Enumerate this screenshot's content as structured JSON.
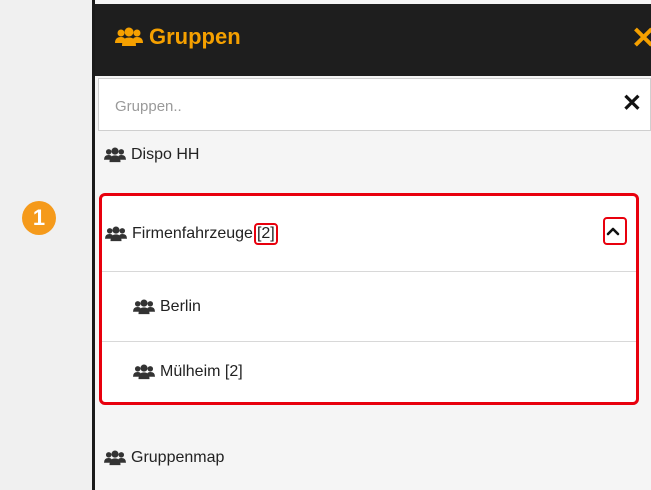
{
  "header": {
    "title": "Gruppen",
    "icon": "users-icon",
    "close_icon": "close-icon",
    "accent": "#f5a000"
  },
  "search": {
    "placeholder": "Gruppen..",
    "value": "",
    "clear_icon": "close-icon"
  },
  "groups": [
    {
      "label": "Dispo HH",
      "icon": "users-icon"
    },
    {
      "label": "Firmenfahrzeuge",
      "count": "[2]",
      "icon": "users-icon",
      "expanded": true,
      "toggle_icon": "chevron-up-icon",
      "children": [
        {
          "label": "Berlin",
          "icon": "users-icon"
        },
        {
          "label": "Mülheim [2]",
          "icon": "users-icon"
        }
      ]
    },
    {
      "label": "Gruppenmap",
      "icon": "users-icon"
    }
  ],
  "callout": {
    "number": "1",
    "color": "#f59a1b"
  },
  "highlight_color": "#e8000d"
}
